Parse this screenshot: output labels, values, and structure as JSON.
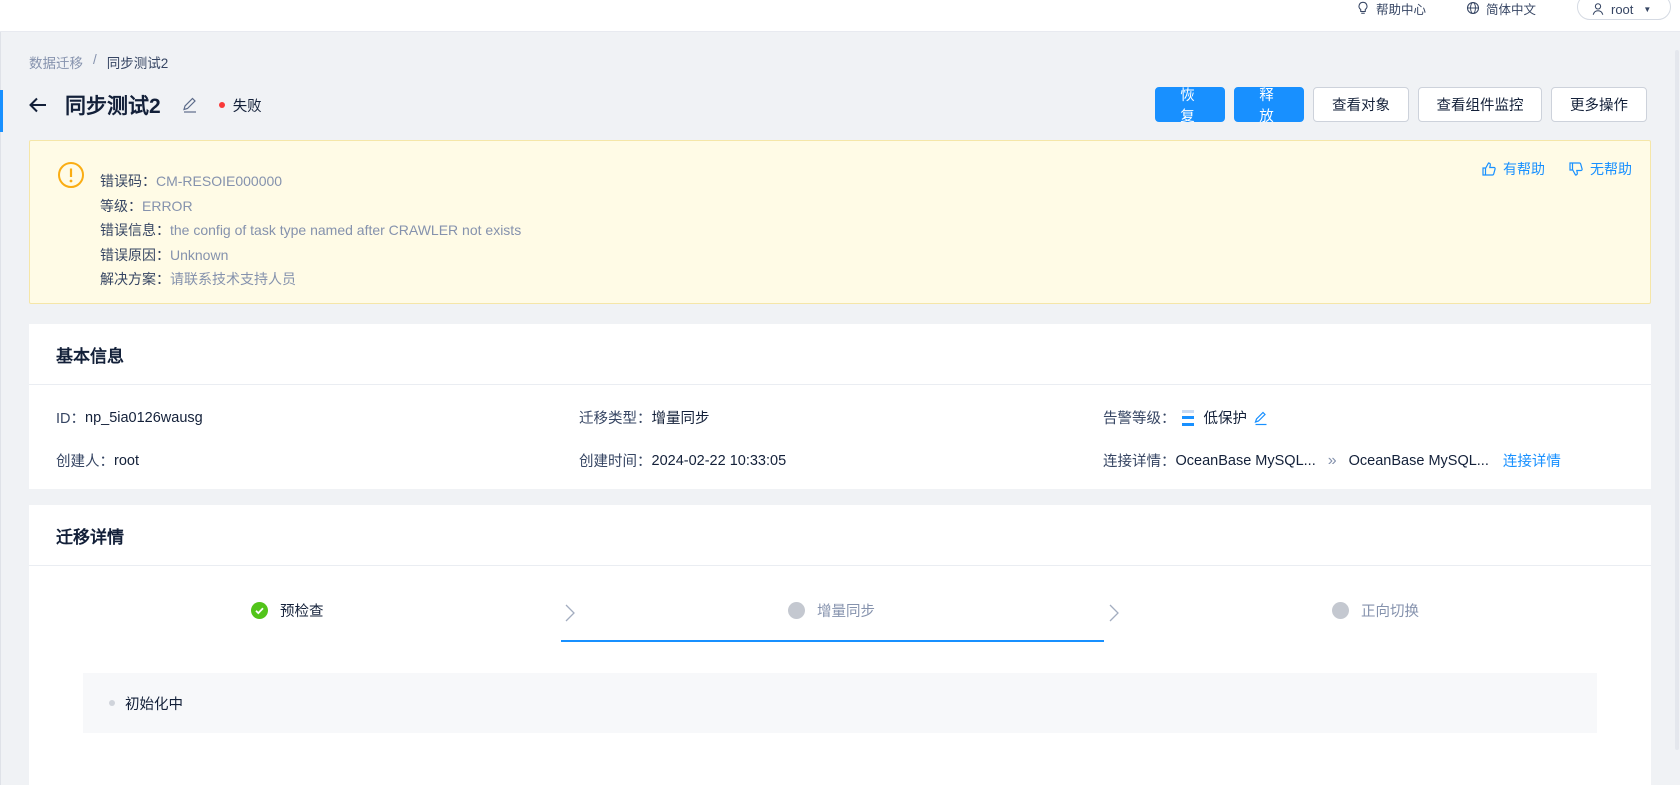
{
  "topbar": {
    "help": "帮助中心",
    "language": "简体中文",
    "user": "root"
  },
  "breadcrumb": {
    "parent": "数据迁移",
    "separator": "/",
    "current": "同步测试2"
  },
  "header": {
    "title": "同步测试2",
    "status": "失败",
    "status_color": "#f93939"
  },
  "actions": {
    "resume": "恢复",
    "release": "释放",
    "view_objects": "查看对象",
    "view_monitor": "查看组件监控",
    "more": "更多操作"
  },
  "alert": {
    "error_code_label": "错误码：",
    "error_code": "CM-RESOIE000000",
    "level_label": "等级：",
    "level": "ERROR",
    "message_label": "错误信息：",
    "message": "the config of task type named after CRAWLER not exists",
    "reason_label": "错误原因：",
    "reason": "Unknown",
    "solution_label": "解决方案：",
    "solution": "请联系技术支持人员",
    "helpful": "有帮助",
    "not_helpful": "无帮助"
  },
  "basic_info": {
    "title": "基本信息",
    "id_label": "ID：",
    "id": "np_5ia0126wausg",
    "type_label": "迁移类型：",
    "type": "增量同步",
    "alert_level_label": "告警等级：",
    "alert_level": "低保护",
    "creator_label": "创建人：",
    "creator": "root",
    "created_label": "创建时间：",
    "created": "2024-02-22 10:33:05",
    "conn_label": "连接详情：",
    "conn_source": "OceanBase MySQL...",
    "conn_arrow": "»",
    "conn_target": "OceanBase MySQL...",
    "conn_link": "连接详情"
  },
  "migration_detail": {
    "title": "迁移详情",
    "steps": [
      {
        "label": "预检查",
        "state": "done"
      },
      {
        "label": "增量同步",
        "state": "active"
      },
      {
        "label": "正向切换",
        "state": "wait"
      }
    ],
    "progress_text": "初始化中"
  },
  "colors": {
    "primary": "#1890ff",
    "success": "#52c41a",
    "alert_bg": "#fffbe6",
    "warning": "#faad14"
  }
}
